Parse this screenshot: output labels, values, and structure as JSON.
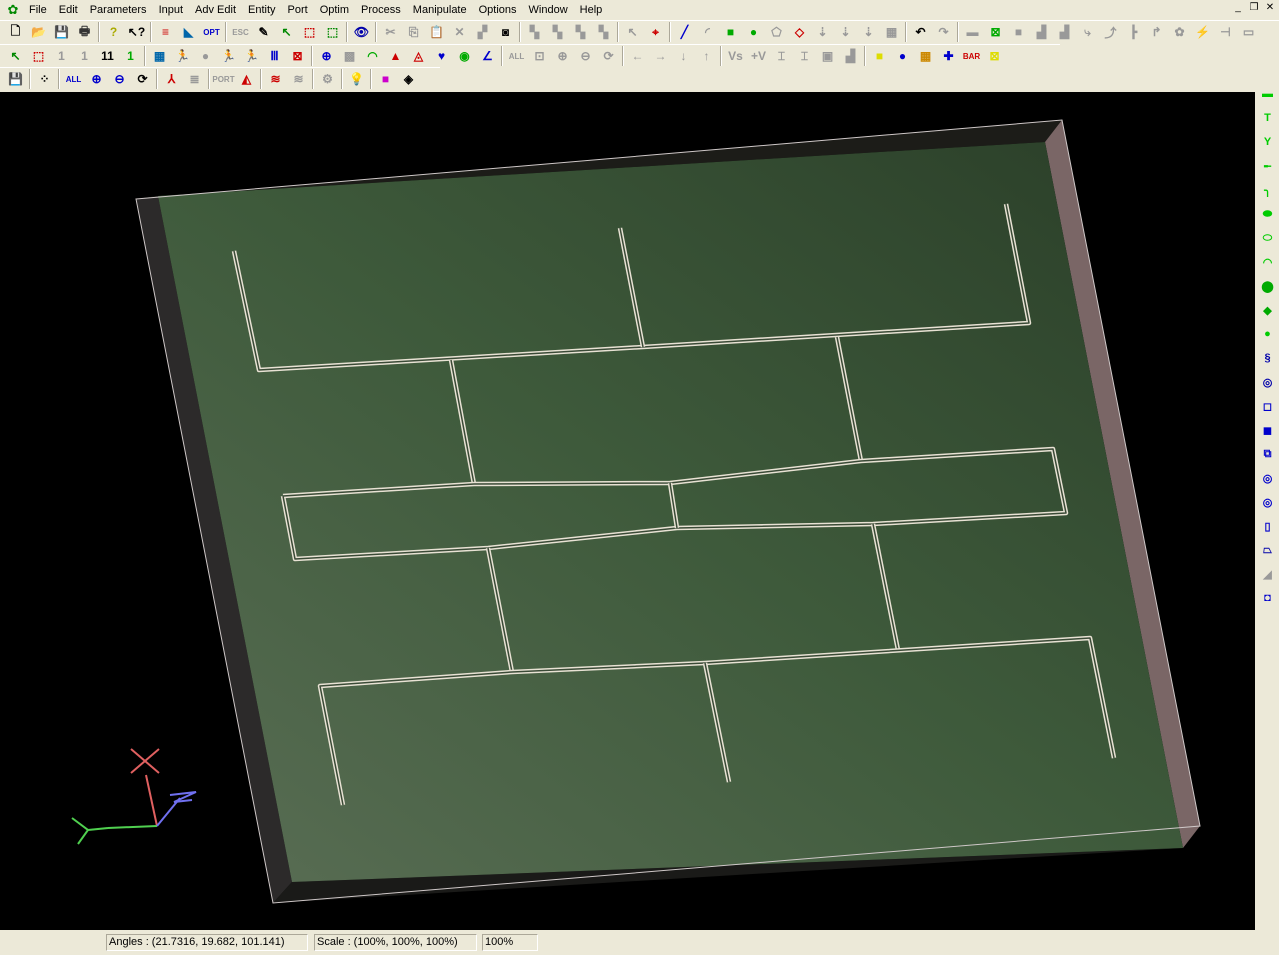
{
  "app": {
    "logo": "ZLB"
  },
  "menu": [
    "File",
    "Edit",
    "Parameters",
    "Input",
    "Adv Edit",
    "Entity",
    "Port",
    "Optim",
    "Process",
    "Manipulate",
    "Options",
    "Window",
    "Help"
  ],
  "window_controls": [
    "_",
    "❐",
    "✕"
  ],
  "toolbar1": [
    {
      "name": "new-file-icon",
      "g": "🗋",
      "c": "#000"
    },
    {
      "name": "open-folder-icon",
      "g": "📂",
      "c": "#b80"
    },
    {
      "name": "save-icon",
      "g": "💾",
      "c": "#000"
    },
    {
      "name": "print-icon",
      "g": "🖶",
      "c": "#333"
    },
    "|",
    {
      "name": "help-icon",
      "g": "?",
      "c": "#aa0"
    },
    {
      "name": "context-help-icon",
      "g": "↖?",
      "c": "#000"
    },
    "|",
    {
      "name": "layers-icon",
      "g": "≡",
      "c": "#c00"
    },
    {
      "name": "substrate-icon",
      "g": "◣",
      "c": "#06a"
    },
    {
      "name": "opt-icon",
      "g": "OPT",
      "c": "#00c"
    },
    "|",
    {
      "name": "esc-icon",
      "g": "ESC",
      "c": "#999"
    },
    {
      "name": "pencil-icon",
      "g": "✎",
      "c": "#000"
    },
    {
      "name": "select-arrow-icon",
      "g": "↖",
      "c": "#080"
    },
    {
      "name": "select-box-icon",
      "g": "⬚",
      "c": "#c00"
    },
    {
      "name": "select-box2-icon",
      "g": "⬚",
      "c": "#080"
    },
    "|",
    {
      "name": "view-eye-icon",
      "g": "👁",
      "c": "#00a"
    },
    "|",
    {
      "name": "cut-icon",
      "g": "✂",
      "c": "#999"
    },
    {
      "name": "copy-icon",
      "g": "⎘",
      "c": "#999"
    },
    {
      "name": "paste-icon",
      "g": "📋",
      "c": "#999"
    },
    {
      "name": "delete-icon",
      "g": "✕",
      "c": "#999"
    },
    {
      "name": "move-icon",
      "g": "▞",
      "c": "#999"
    },
    {
      "name": "snapshot-icon",
      "g": "◙",
      "c": "#000"
    },
    "|",
    {
      "name": "align1-icon",
      "g": "▚",
      "c": "#999"
    },
    {
      "name": "align2-icon",
      "g": "▚",
      "c": "#999"
    },
    {
      "name": "align3-icon",
      "g": "▚",
      "c": "#999"
    },
    {
      "name": "align4-icon",
      "g": "▚",
      "c": "#999"
    },
    "|",
    {
      "name": "pointer-icon",
      "g": "↖",
      "c": "#999"
    },
    {
      "name": "snap-icon",
      "g": "⌖",
      "c": "#c00"
    },
    "|",
    {
      "name": "line-icon",
      "g": "╱",
      "c": "#00c"
    },
    {
      "name": "arc-icon",
      "g": "◜",
      "c": "#999"
    },
    {
      "name": "rectangle-icon",
      "g": "■",
      "c": "#0a0"
    },
    {
      "name": "circle-icon",
      "g": "●",
      "c": "#0a0"
    },
    {
      "name": "polygon-icon",
      "g": "⬠",
      "c": "#999"
    },
    {
      "name": "shape-icon",
      "g": "◇",
      "c": "#c00"
    },
    {
      "name": "via-icon",
      "g": "⇣",
      "c": "#999"
    },
    {
      "name": "via2-icon",
      "g": "⇣",
      "c": "#999"
    },
    {
      "name": "via3-icon",
      "g": "⇣",
      "c": "#999"
    },
    {
      "name": "grid-icon",
      "g": "▦",
      "c": "#999"
    },
    "|",
    {
      "name": "undo-icon",
      "g": "↶",
      "c": "#000"
    },
    {
      "name": "redo-icon",
      "g": "↷",
      "c": "#999"
    },
    "|",
    {
      "name": "tool1-icon",
      "g": "▬",
      "c": "#999"
    },
    {
      "name": "tool2-icon",
      "g": "⊠",
      "c": "#0a0"
    },
    {
      "name": "tool3-icon",
      "g": "■",
      "c": "#999"
    },
    {
      "name": "tool4-icon",
      "g": "▟",
      "c": "#999"
    },
    {
      "name": "tool5-icon",
      "g": "▟",
      "c": "#999"
    },
    {
      "name": "tool6-icon",
      "g": "⤷",
      "c": "#999"
    },
    {
      "name": "tool7-icon",
      "g": "⤴",
      "c": "#999"
    },
    {
      "name": "tool8-icon",
      "g": "┣",
      "c": "#999"
    },
    {
      "name": "tool9-icon",
      "g": "↱",
      "c": "#999"
    },
    {
      "name": "tool10-icon",
      "g": "✿",
      "c": "#999"
    },
    {
      "name": "tool11-icon",
      "g": "⚡",
      "c": "#aa0"
    },
    {
      "name": "tool12-icon",
      "g": "⊣",
      "c": "#999"
    },
    {
      "name": "tool13-icon",
      "g": "▭",
      "c": "#999"
    }
  ],
  "toolbar2": [
    {
      "name": "select-green-icon",
      "g": "↖",
      "c": "#080"
    },
    {
      "name": "select-red-icon",
      "g": "⬚",
      "c": "#c00"
    },
    {
      "name": "box1-icon",
      "g": "1",
      "c": "#999"
    },
    {
      "name": "box1b-icon",
      "g": "1",
      "c": "#999"
    },
    {
      "name": "box11-icon",
      "g": "11",
      "c": "#000"
    },
    {
      "name": "box1c-icon",
      "g": "1",
      "c": "#0a0"
    },
    "|",
    {
      "name": "mesh-icon",
      "g": "▦",
      "c": "#06a"
    },
    {
      "name": "run-icon",
      "g": "🏃",
      "c": "#00c"
    },
    {
      "name": "stop-icon",
      "g": "●",
      "c": "#999"
    },
    {
      "name": "run2-icon",
      "g": "🏃",
      "c": "#00c"
    },
    {
      "name": "run3-icon",
      "g": "🏃",
      "c": "#00c"
    },
    {
      "name": "bars-icon",
      "g": "Ⅲ",
      "c": "#00c"
    },
    {
      "name": "window-icon",
      "g": "⊠",
      "c": "#c00"
    },
    "|",
    {
      "name": "smith-icon",
      "g": "⊕",
      "c": "#00c"
    },
    {
      "name": "plot-icon",
      "g": "▩",
      "c": "#999"
    },
    {
      "name": "arc-plot-icon",
      "g": "◠",
      "c": "#0a0"
    },
    {
      "name": "radiation-icon",
      "g": "▲",
      "c": "#c00"
    },
    {
      "name": "pattern-icon",
      "g": "◬",
      "c": "#c00"
    },
    {
      "name": "heart-icon",
      "g": "♥",
      "c": "#00c"
    },
    {
      "name": "field-icon",
      "g": "◉",
      "c": "#0a0"
    },
    {
      "name": "graph-icon",
      "g": "∠",
      "c": "#00c"
    },
    "|",
    {
      "name": "all-icon",
      "g": "ALL",
      "c": "#999"
    },
    {
      "name": "zoom-box-icon",
      "g": "⊡",
      "c": "#999"
    },
    {
      "name": "zoom-in-icon",
      "g": "⊕",
      "c": "#999"
    },
    {
      "name": "zoom-out-icon",
      "g": "⊖",
      "c": "#999"
    },
    {
      "name": "refresh-icon",
      "g": "⟳",
      "c": "#999"
    },
    "|",
    {
      "name": "left-arrow-icon",
      "g": "←",
      "c": "#999"
    },
    {
      "name": "right-arrow-icon",
      "g": "→",
      "c": "#999"
    },
    {
      "name": "down-arrow-icon",
      "g": "↓",
      "c": "#999"
    },
    {
      "name": "up-arrow-icon",
      "g": "↑",
      "c": "#999"
    },
    "|",
    {
      "name": "vs-icon",
      "g": "Vs",
      "c": "#999"
    },
    {
      "name": "v-icon",
      "g": "+V",
      "c": "#999"
    },
    {
      "name": "dim1-icon",
      "g": "⌶",
      "c": "#999"
    },
    {
      "name": "dim2-icon",
      "g": "⌶",
      "c": "#999"
    },
    {
      "name": "box-icon",
      "g": "▣",
      "c": "#999"
    },
    {
      "name": "box2-icon",
      "g": "▟",
      "c": "#999"
    },
    "|",
    {
      "name": "color1-icon",
      "g": "■",
      "c": "#dd0"
    },
    {
      "name": "sphere-icon",
      "g": "●",
      "c": "#00c"
    },
    {
      "name": "color3-icon",
      "g": "▦",
      "c": "#c80"
    },
    {
      "name": "color4-icon",
      "g": "✚",
      "c": "#00c"
    },
    {
      "name": "bar-icon",
      "g": "BAR",
      "c": "#c00"
    },
    {
      "name": "xy-icon",
      "g": "⊠",
      "c": "#dd0"
    }
  ],
  "toolbar3": [
    {
      "name": "save-icon",
      "g": "💾",
      "c": "#000"
    },
    "|",
    {
      "name": "grid-dots-icon",
      "g": "⁘",
      "c": "#000"
    },
    "|",
    {
      "name": "all-icon",
      "g": "ALL",
      "c": "#00c"
    },
    {
      "name": "zoom-in-icon",
      "g": "⊕",
      "c": "#00c"
    },
    {
      "name": "zoom-out-icon",
      "g": "⊖",
      "c": "#00c"
    },
    {
      "name": "rotate-icon",
      "g": "⟳",
      "c": "#000"
    },
    "|",
    {
      "name": "axes-icon",
      "g": "⅄",
      "c": "#c00"
    },
    {
      "name": "list-icon",
      "g": "≣",
      "c": "#999"
    },
    "|",
    {
      "name": "port-icon",
      "g": "PORT",
      "c": "#999"
    },
    {
      "name": "angle-icon",
      "g": "◭",
      "c": "#c00"
    },
    "|",
    {
      "name": "wave-icon",
      "g": "≋",
      "c": "#c00"
    },
    {
      "name": "wave2-icon",
      "g": "≋",
      "c": "#999"
    },
    "|",
    {
      "name": "gear-icon",
      "g": "⚙",
      "c": "#999"
    },
    "|",
    {
      "name": "bulb-icon",
      "g": "💡",
      "c": "#dd0"
    },
    "|",
    {
      "name": "color-box-icon",
      "g": "■",
      "c": "#c0c"
    },
    {
      "name": "fill-icon",
      "g": "◈",
      "c": "#000"
    }
  ],
  "rightbar": [
    {
      "name": "line-tool-icon",
      "g": "▬",
      "c": "#0c0"
    },
    {
      "name": "tee-icon",
      "g": "T",
      "c": "#0c0"
    },
    {
      "name": "y-junction-icon",
      "g": "Y",
      "c": "#0c0"
    },
    {
      "name": "step-icon",
      "g": "╾",
      "c": "#0c0"
    },
    {
      "name": "bend-icon",
      "g": "╮",
      "c": "#0c0"
    },
    {
      "name": "ellipse-icon",
      "g": "⬬",
      "c": "#0c0"
    },
    {
      "name": "ring-icon",
      "g": "⬭",
      "c": "#0c0"
    },
    {
      "name": "arc-icon",
      "g": "◠",
      "c": "#0c0"
    },
    {
      "name": "cylinder-icon",
      "g": "⬤",
      "c": "#0a0"
    },
    {
      "name": "cone-icon",
      "g": "◆",
      "c": "#0a0"
    },
    {
      "name": "sphere-icon",
      "g": "●",
      "c": "#0c0"
    },
    {
      "name": "spiral-icon",
      "g": "§",
      "c": "#00a"
    },
    {
      "name": "helix-icon",
      "g": "◎",
      "c": "#00a"
    },
    {
      "name": "square-icon",
      "g": "◻",
      "c": "#00c"
    },
    {
      "name": "square2-icon",
      "g": "◼",
      "c": "#00c"
    },
    {
      "name": "copy-shape-icon",
      "g": "⧉",
      "c": "#00c"
    },
    {
      "name": "loop-icon",
      "g": "◎",
      "c": "#00c"
    },
    {
      "name": "loop2-icon",
      "g": "◎",
      "c": "#00c"
    },
    {
      "name": "tube-icon",
      "g": "▯",
      "c": "#00c"
    },
    {
      "name": "trap-icon",
      "g": "⏢",
      "c": "#00a"
    },
    {
      "name": "slope-icon",
      "g": "◢",
      "c": "#999"
    },
    {
      "name": "box-icon",
      "g": "◘",
      "c": "#00c"
    }
  ],
  "status": {
    "angles": "Angles : (21.7316, 19.682, 101.141)",
    "scale": "Scale : (100%, 100%, 100%)",
    "zoom": "100%"
  },
  "colors": {
    "substrate": "#3f5a3c",
    "trace": "#e8e2d4",
    "background": "#000000"
  }
}
